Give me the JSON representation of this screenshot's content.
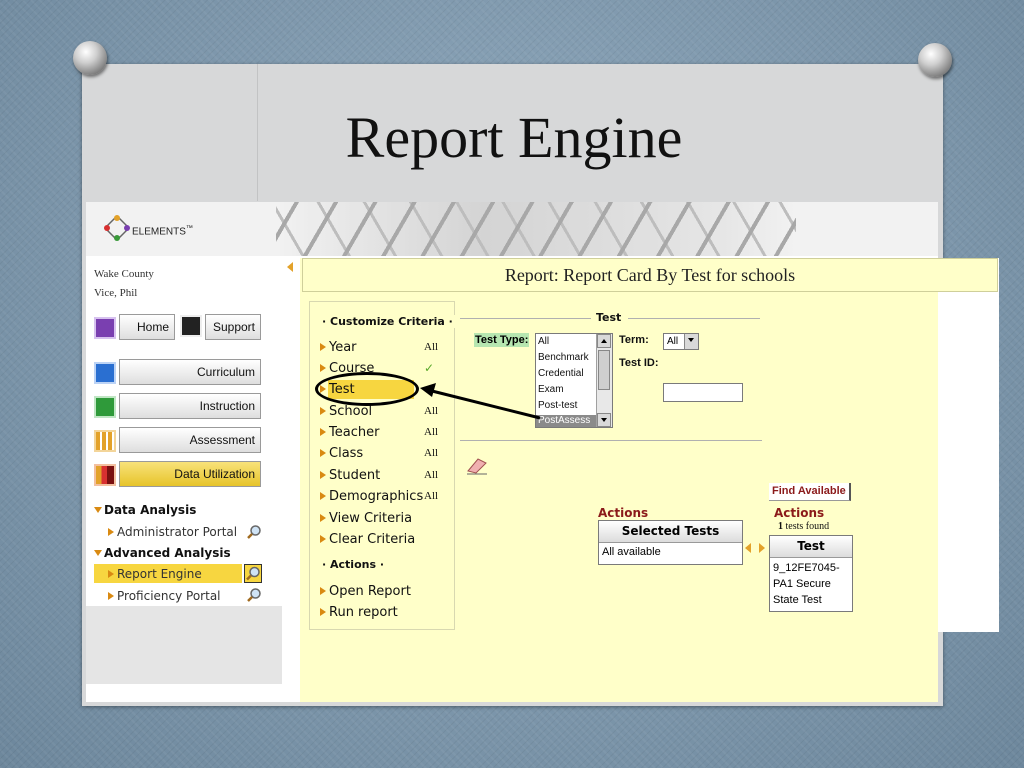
{
  "slide": {
    "title": "Report Engine"
  },
  "app": {
    "brand": "ELEMENTS",
    "brand_tm": "™",
    "user": {
      "district": "Wake County",
      "name": "Vice, Phil"
    }
  },
  "nav": {
    "home": "Home",
    "support": "Support",
    "curriculum": "Curriculum",
    "instruction": "Instruction",
    "assessment": "Assessment",
    "data_utilization": "Data Utilization"
  },
  "tree": {
    "data_analysis": "Data Analysis",
    "administrator_portal": "Administrator Portal",
    "advanced_analysis": "Advanced Analysis",
    "report_engine": "Report Engine",
    "proficiency_portal": "Proficiency Portal"
  },
  "report": {
    "title": "Report: Report Card By Test for schools"
  },
  "criteria": {
    "heading": "Customize Criteria",
    "items": [
      {
        "label": "Year",
        "value": "All"
      },
      {
        "label": "Course",
        "value": ""
      },
      {
        "label": "Test",
        "value": ""
      },
      {
        "label": "School",
        "value": "All"
      },
      {
        "label": "Teacher",
        "value": "All"
      },
      {
        "label": "Class",
        "value": "All"
      },
      {
        "label": "Student",
        "value": "All"
      },
      {
        "label": "Demographics",
        "value": "All"
      },
      {
        "label": "View Criteria",
        "value": ""
      },
      {
        "label": "Clear Criteria",
        "value": ""
      }
    ],
    "course_check": "✓",
    "actions_heading": "Actions",
    "actions": [
      "Open Report",
      "Run report"
    ]
  },
  "test_panel": {
    "legend": "Test",
    "test_type_label": "Test Type:",
    "test_type_options": [
      "All",
      "Benchmark",
      "Credential",
      "Exam",
      "Post-test",
      "PostAssess"
    ],
    "test_type_selected": "PostAssess",
    "term_label": "Term:",
    "term_value": "All",
    "test_id_label": "Test ID:",
    "test_id_value": ""
  },
  "results": {
    "actions_left": "Actions",
    "actions_right": "Actions",
    "find_available": "Find Available",
    "found_count": "1",
    "found_suffix": " tests found",
    "selected_tests_header": "Selected Tests",
    "selected_tests_value": "All available",
    "test_header": "Test",
    "test_value": "9_12FE7045-PA1 Secure State Test"
  },
  "colors": {
    "highlight": "#f7d640",
    "panel": "#ffffc9",
    "actions_text": "#8b1a1a",
    "bullet": "#e3a22a"
  }
}
